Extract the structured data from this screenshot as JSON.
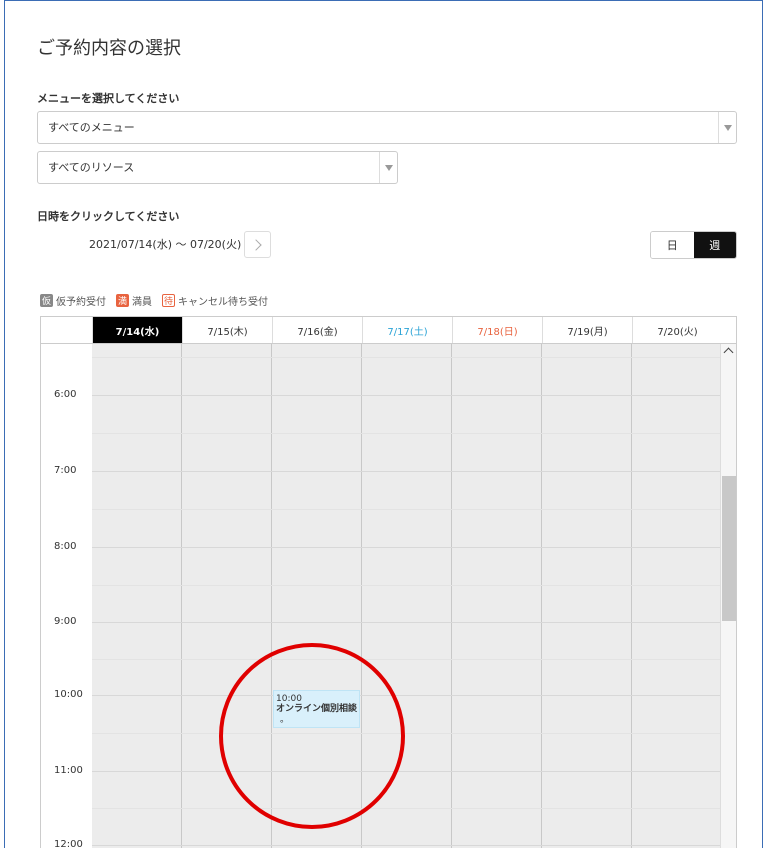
{
  "page": {
    "title": "ご予約内容の選択",
    "menu_label": "メニューを選択してください",
    "menu_select": "すべてのメニュー",
    "resource_select": "すべてのリソース",
    "datetime_label": "日時をクリックしてください",
    "date_range": "2021/07/14(水) ～ 07/20(火)"
  },
  "view_toggle": {
    "day": "日",
    "week": "週",
    "active": "week"
  },
  "legend": [
    {
      "badge": "仮",
      "label": "仮予約受付",
      "kind": "kari"
    },
    {
      "badge": "満",
      "label": "満員",
      "kind": "man"
    },
    {
      "badge": "待",
      "label": "キャンセル待ち受付",
      "kind": "machi"
    }
  ],
  "calendar": {
    "days": [
      {
        "label": "7/14(水)",
        "kind": "selected"
      },
      {
        "label": "7/15(木)",
        "kind": "weekday"
      },
      {
        "label": "7/16(金)",
        "kind": "weekday"
      },
      {
        "label": "7/17(土)",
        "kind": "sat"
      },
      {
        "label": "7/18(日)",
        "kind": "sun"
      },
      {
        "label": "7/19(月)",
        "kind": "weekday"
      },
      {
        "label": "7/20(火)",
        "kind": "weekday"
      }
    ],
    "times": [
      "6:00",
      "7:00",
      "8:00",
      "9:00",
      "10:00",
      "11:00",
      "12:00"
    ],
    "event": {
      "time": "10:00",
      "title": "オンライン個別相談",
      "tail": "。"
    }
  },
  "colors": {
    "selected_day": "#000000",
    "saturday": "#2aa3d6",
    "sunday": "#e8633f",
    "event_bg": "#d9f0fb",
    "annotation_circle": "#e00000"
  }
}
